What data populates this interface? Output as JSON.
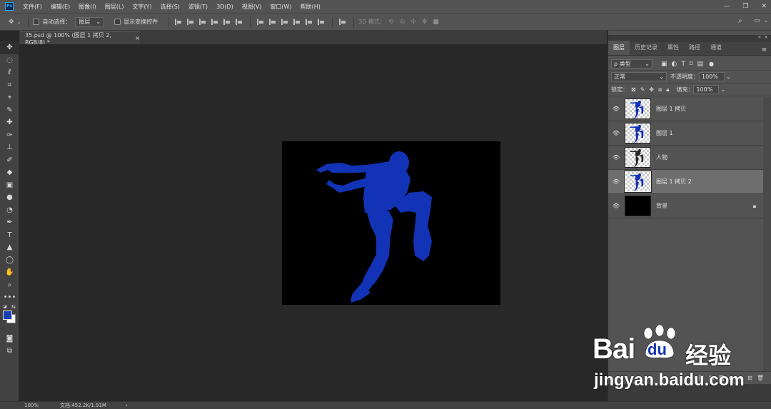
{
  "app": {
    "logo": "Ps"
  },
  "menu": [
    "文件(F)",
    "编辑(E)",
    "图像(I)",
    "图层(L)",
    "文字(Y)",
    "选择(S)",
    "滤镜(T)",
    "3D(D)",
    "视图(V)",
    "窗口(W)",
    "帮助(H)"
  ],
  "window_controls": {
    "minimize": "—",
    "restore": "❐",
    "close": "✕"
  },
  "options": {
    "auto_select_label": "自动选择：",
    "auto_select_value": "图层",
    "show_transform_label": "显示变换控件",
    "mode_3d_label": "3D 模式："
  },
  "document": {
    "tab_title": "35.psd @ 100% (图层 1 拷贝 2, RGB/8) *",
    "tab_close": "×"
  },
  "status": {
    "zoom": "100%",
    "doc_info": "文档:452.2K/1.91M",
    "arrow": "›"
  },
  "panel": {
    "tabs": [
      "图层",
      "历史记录",
      "属性",
      "路径",
      "通道"
    ],
    "filter_kind": "ρ 类型",
    "blend_mode": "正常",
    "opacity_label": "不透明度：",
    "opacity_value": "100%",
    "lock_label": "锁定：",
    "fill_label": "填充：",
    "fill_value": "100%"
  },
  "layers": [
    {
      "name": "图层 1 拷贝",
      "thumb": "blue-dancer",
      "selected": false,
      "locked": false
    },
    {
      "name": "图层 1",
      "thumb": "blue-dancer",
      "selected": false,
      "locked": false
    },
    {
      "name": "人物",
      "thumb": "photo-dancer",
      "selected": false,
      "locked": false
    },
    {
      "name": "图层 1 拷贝 2",
      "thumb": "blue-dancer",
      "selected": true,
      "locked": false
    },
    {
      "name": "背景",
      "thumb": "black",
      "selected": false,
      "locked": true
    }
  ],
  "watermark": {
    "brand": "Bai",
    "brand2": "du",
    "cn": "经验",
    "url": "jingyan.baidu.com"
  },
  "colors": {
    "silhouette": "#1233b6",
    "foreground": "#1a3fb0",
    "background_swatch": "#ffffff",
    "selected_layer": "#6e6e6e"
  }
}
